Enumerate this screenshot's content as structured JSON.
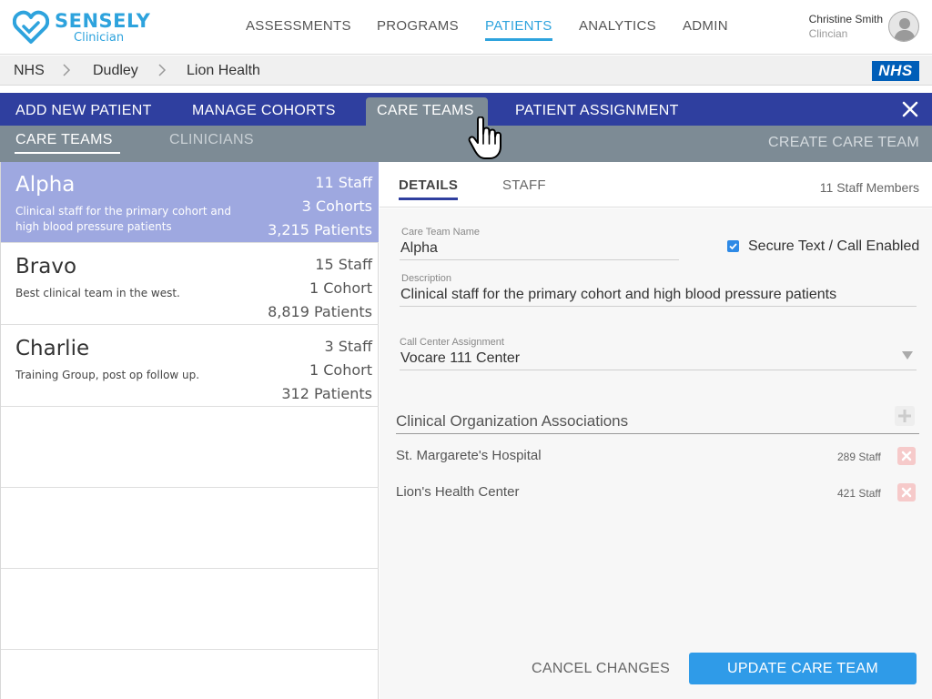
{
  "brand": {
    "name": "SENSELY",
    "sub": "Clinician"
  },
  "nav": [
    {
      "label": "ASSESSMENTS"
    },
    {
      "label": "PROGRAMS"
    },
    {
      "label": "PATIENTS"
    },
    {
      "label": "ANALYTICS"
    },
    {
      "label": "ADMIN"
    }
  ],
  "user": {
    "name": "Christine Smith",
    "role": "Clincian"
  },
  "breadcrumb": [
    "NHS",
    "Dudley",
    "Lion Health"
  ],
  "nhs_logo": "NHS",
  "subnav": [
    {
      "label": "ADD NEW PATIENT"
    },
    {
      "label": "MANAGE COHORTS"
    },
    {
      "label": "CARE TEAMS"
    },
    {
      "label": "PATIENT ASSIGNMENT"
    }
  ],
  "tabs": [
    {
      "label": "CARE TEAMS"
    },
    {
      "label": "CLINICIANS"
    }
  ],
  "create_label": "CREATE CARE TEAM",
  "teams": [
    {
      "name": "Alpha",
      "desc": "Clinical staff for the primary cohort and high blood pressure patients",
      "staff": "11 Staff",
      "cohorts": "3 Cohorts",
      "patients": "3,215 Patients"
    },
    {
      "name": "Bravo",
      "desc": "Best clinical team in the west.",
      "staff": "15 Staff",
      "cohorts": "1 Cohort",
      "patients": "8,819 Patients"
    },
    {
      "name": "Charlie",
      "desc": "Training Group, post op follow up.",
      "staff": "3 Staff",
      "cohorts": "1 Cohort",
      "patients": "312 Patients"
    }
  ],
  "detail": {
    "tabs": [
      {
        "label": "DETAILS"
      },
      {
        "label": "STAFF"
      }
    ],
    "staff_count": "11 Staff Members",
    "name_label": "Care Team Name",
    "name_value": "Alpha",
    "secure_label": "Secure Text / Call Enabled",
    "desc_label": "Description",
    "desc_value": "Clinical staff for the primary cohort and high blood pressure patients",
    "call_label": "Call Center Assignment",
    "call_value": "Vocare 111 Center",
    "org_title": "Clinical Organization Associations",
    "orgs": [
      {
        "name": "St. Margarete's Hospital",
        "staff": "289 Staff"
      },
      {
        "name": "Lion's Health Center",
        "staff": "421 Staff"
      }
    ],
    "cancel_label": "CANCEL CHANGES",
    "update_label": "UPDATE CARE TEAM"
  },
  "colors": {
    "accent": "#2ea3dd",
    "subnav": "#2f3f9f",
    "tabbar": "#7d8b95",
    "selected": "#9ea8e0",
    "primary_button": "#2f9be8"
  }
}
